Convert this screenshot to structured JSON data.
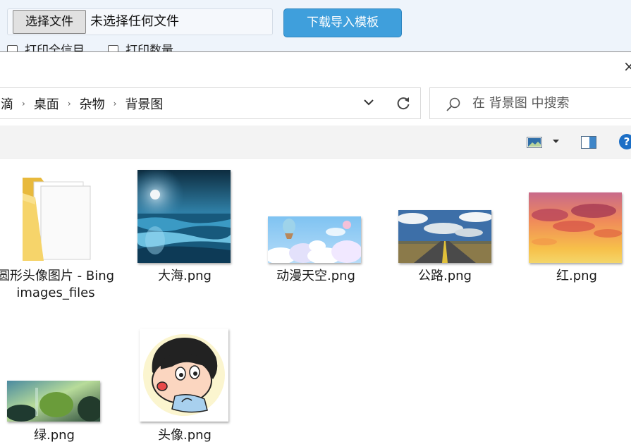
{
  "page": {
    "choose_file_label": "选择文件",
    "no_file_text": "未选择任何文件",
    "download_template_label": "下载导入模板",
    "checkbox_1_label": "打印全信目",
    "checkbox_2_label": "打印数量"
  },
  "dialog": {
    "close_glyph": "×",
    "breadcrumb": [
      "滴",
      "桌面",
      "杂物",
      "背景图"
    ],
    "breadcrumb_separator": "›",
    "search_placeholder": "在 背景图 中搜索",
    "help_glyph": "?"
  },
  "files": [
    {
      "name": "圆形头像图片 - Bing images_files",
      "type": "folder"
    },
    {
      "name": "大海.png",
      "type": "image",
      "thumb": "sea"
    },
    {
      "name": "动漫天空.png",
      "type": "image",
      "thumb": "anime-sky"
    },
    {
      "name": "公路.png",
      "type": "image",
      "thumb": "road"
    },
    {
      "name": "红.png",
      "type": "image",
      "thumb": "red-sky"
    },
    {
      "name": "绿.png",
      "type": "image",
      "thumb": "green-forest"
    },
    {
      "name": "头像.png",
      "type": "image",
      "thumb": "cartoon-avatar"
    }
  ],
  "colors": {
    "download_button": "#3f9fdc",
    "help_icon": "#1c6fc6",
    "toolbar_bg": "#f3f3f3",
    "page_bg": "#eef4fb"
  }
}
